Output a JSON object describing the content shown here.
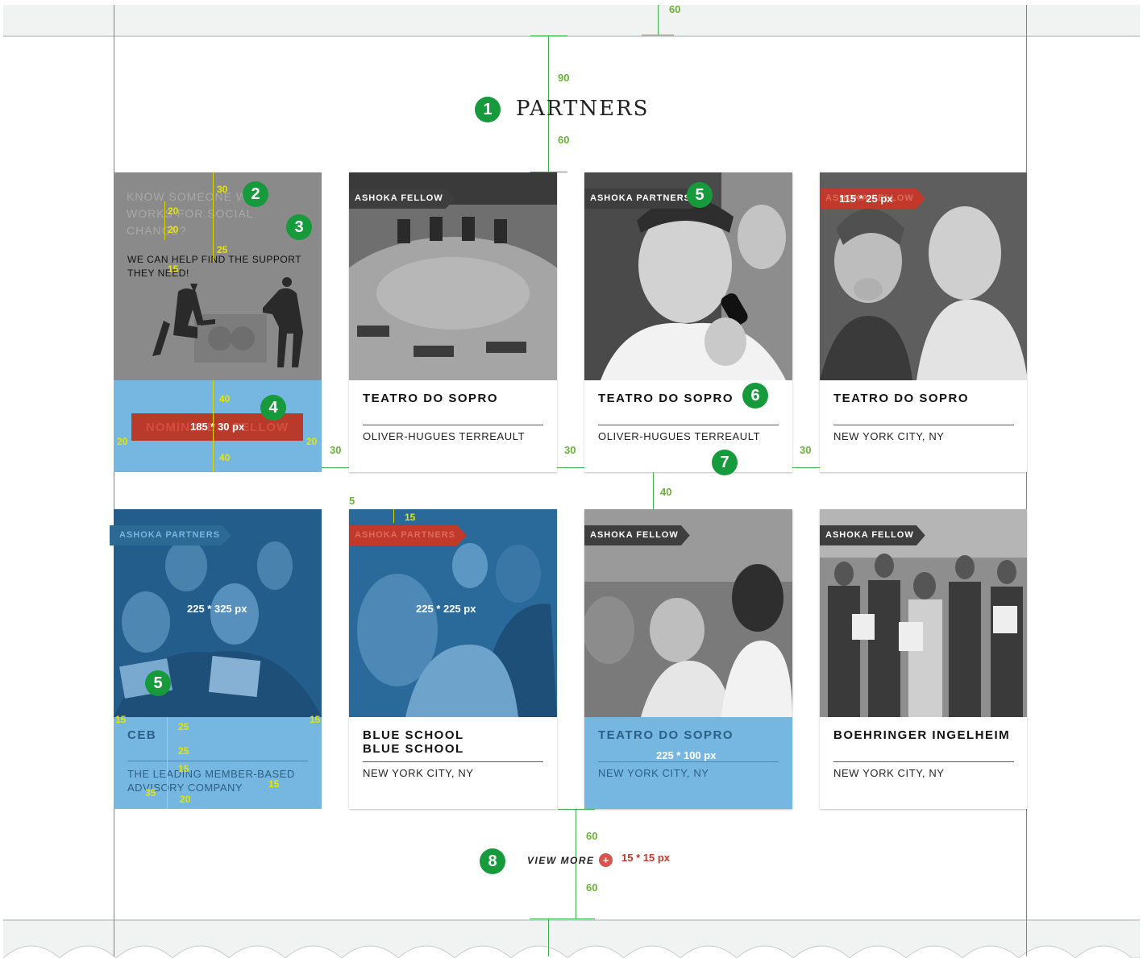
{
  "header": {
    "title": "PARTNERS"
  },
  "dimensions": {
    "top_gap": "60",
    "title_top": "90",
    "title_bottom": "60",
    "gutter": "30",
    "row_gap": "40",
    "ribbon_offset": "5",
    "ribbon_pad": "15",
    "bottom_top": "60",
    "bottom_bottom": "60",
    "promo_top": "30",
    "promo_line1": "20",
    "promo_line2": "20",
    "promo_gap": "25",
    "promo_15": "15",
    "btn_top": "40",
    "btn_bottom": "40",
    "btn_left": "20",
    "btn_right": "20",
    "info_left": "15",
    "info_right": "15",
    "info_a": "25",
    "info_b": "25",
    "info_c": "15",
    "info_d": "15",
    "info_e": "35",
    "info_f": "20"
  },
  "markers": [
    "1",
    "2",
    "3",
    "4",
    "5",
    "6",
    "7",
    "8",
    "5"
  ],
  "promo": {
    "heading": "KNOW SOMEONE WHO WORKS FOR SOCIAL CHANGE?",
    "text": "WE CAN HELP FIND THE SUPPORT THEY NEED!",
    "button": "NOMINATE A FELLOW",
    "button_size": "185 * 30 px"
  },
  "cards": [
    {
      "ribbon": "ASHOKA FELLOW",
      "title": "TEATRO DO SOPRO",
      "subtitle": "OLIVER-HUGUES TERREAULT"
    },
    {
      "ribbon": "ASHOKA PARTNERS",
      "title": "TEATRO DO SOPRO",
      "subtitle": "OLIVER-HUGUES TERREAULT"
    },
    {
      "ribbon": "ASHOKA FELLOW",
      "ribbon_size": "115 * 25 px",
      "title": "TEATRO DO SOPRO",
      "subtitle": "NEW YORK CITY, NY"
    },
    {
      "ribbon": "ASHOKA PARTNERS",
      "title": "CEB",
      "subtitle": "THE LEADING MEMBER-BASED ADVISORY COMPANY",
      "size": "225 * 325 px"
    },
    {
      "ribbon": "ASHOKA PARTNERS",
      "title": "BLUE SCHOOL",
      "title2": "BLUE SCHOOL",
      "subtitle": "NEW YORK CITY, NY",
      "size": "225 * 225 px"
    },
    {
      "ribbon": "ASHOKA FELLOW",
      "title": "TEATRO DO SOPRO",
      "subtitle": "NEW YORK CITY, NY",
      "size": "225 * 100 px"
    },
    {
      "ribbon": "ASHOKA FELLOW",
      "title": "BOEHRINGER INGELHEIM",
      "subtitle": "NEW YORK CITY, NY"
    }
  ],
  "footer": {
    "view_more": "VIEW MORE",
    "plus": "+",
    "plus_size": "15 * 15 px"
  },
  "colors": {
    "guide": "#3cb04a",
    "marker": "#169a3c",
    "accent_red": "#c0392b",
    "highlight_blue": "#75b7e0"
  }
}
